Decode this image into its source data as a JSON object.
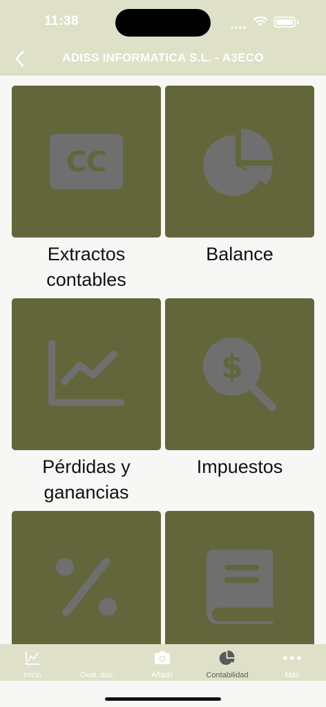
{
  "status_bar": {
    "time": "11:38"
  },
  "header": {
    "title": "ADISS INFORMATICA S.L. - A3ECO"
  },
  "tiles": [
    {
      "label": "Extractos contables",
      "icon": "cc-card-icon"
    },
    {
      "label": "Balance",
      "icon": "pie-chart-icon"
    },
    {
      "label": "Pérdidas y ganancias",
      "icon": "line-chart-icon"
    },
    {
      "label": "Impuestos",
      "icon": "dollar-search-icon"
    },
    {
      "label": "",
      "icon": "percent-icon"
    },
    {
      "label": "",
      "icon": "book-icon"
    }
  ],
  "cc_text": "CC",
  "dollar_text": "$",
  "tab_bar": {
    "items": [
      {
        "label": "Inicio",
        "icon": "line-chart-icon"
      },
      {
        "label": "Gest. doc.",
        "icon": "folder-icon"
      },
      {
        "label": "Añadir",
        "icon": "camera-icon"
      },
      {
        "label": "Contabilidad",
        "icon": "pie-chart-icon"
      },
      {
        "label": "Más",
        "icon": "more-dots-icon"
      }
    ],
    "active_index": 3
  },
  "colors": {
    "header_bg": "#dfe0c8",
    "tile_bg": "#62663a",
    "icon_gray": "#6f6f6f",
    "page_bg": "#f7f7f5"
  }
}
